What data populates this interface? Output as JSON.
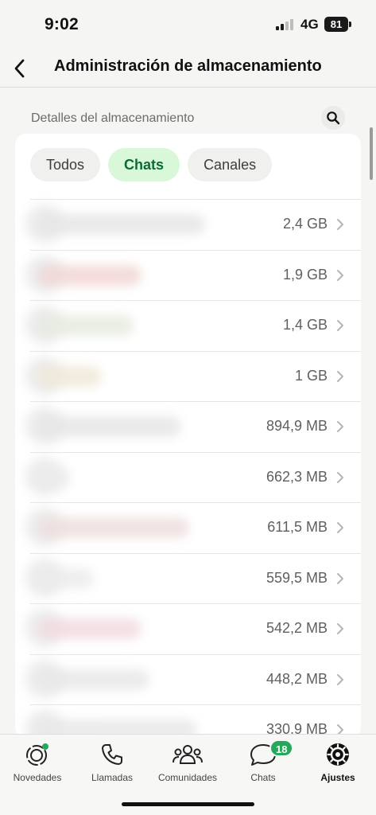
{
  "status_bar": {
    "time": "9:02",
    "network": "4G",
    "battery": "81"
  },
  "header": {
    "title": "Administración de almacenamiento"
  },
  "section": {
    "label": "Detalles del almacenamiento"
  },
  "filters": {
    "items": [
      {
        "label": "Todos",
        "active": false
      },
      {
        "label": "Chats",
        "active": true
      },
      {
        "label": "Canales",
        "active": false
      }
    ]
  },
  "chats": [
    {
      "name": "",
      "size": "2,4 GB"
    },
    {
      "name": "",
      "size": "1,9 GB"
    },
    {
      "name": "",
      "size": "1,4 GB"
    },
    {
      "name": "",
      "size": "1 GB"
    },
    {
      "name": "",
      "size": "894,9 MB"
    },
    {
      "name": "",
      "size": "662,3 MB"
    },
    {
      "name": "",
      "size": "611,5 MB"
    },
    {
      "name": "",
      "size": "559,5 MB"
    },
    {
      "name": "",
      "size": "542,2 MB"
    },
    {
      "name": "",
      "size": "448,2 MB"
    },
    {
      "name": "",
      "size": "330,9 MB"
    }
  ],
  "tab_bar": {
    "tabs": [
      {
        "label": "Novedades",
        "icon": "updates-icon"
      },
      {
        "label": "Llamadas",
        "icon": "phone-icon"
      },
      {
        "label": "Comunidades",
        "icon": "communities-icon"
      },
      {
        "label": "Chats",
        "icon": "chats-icon",
        "badge": "18"
      },
      {
        "label": "Ajustes",
        "icon": "settings-icon",
        "active": true
      }
    ]
  },
  "colors": {
    "accent_green": "#25a85a",
    "chip_active_bg": "#d9f7d9",
    "chip_active_text": "#0d6b34"
  }
}
